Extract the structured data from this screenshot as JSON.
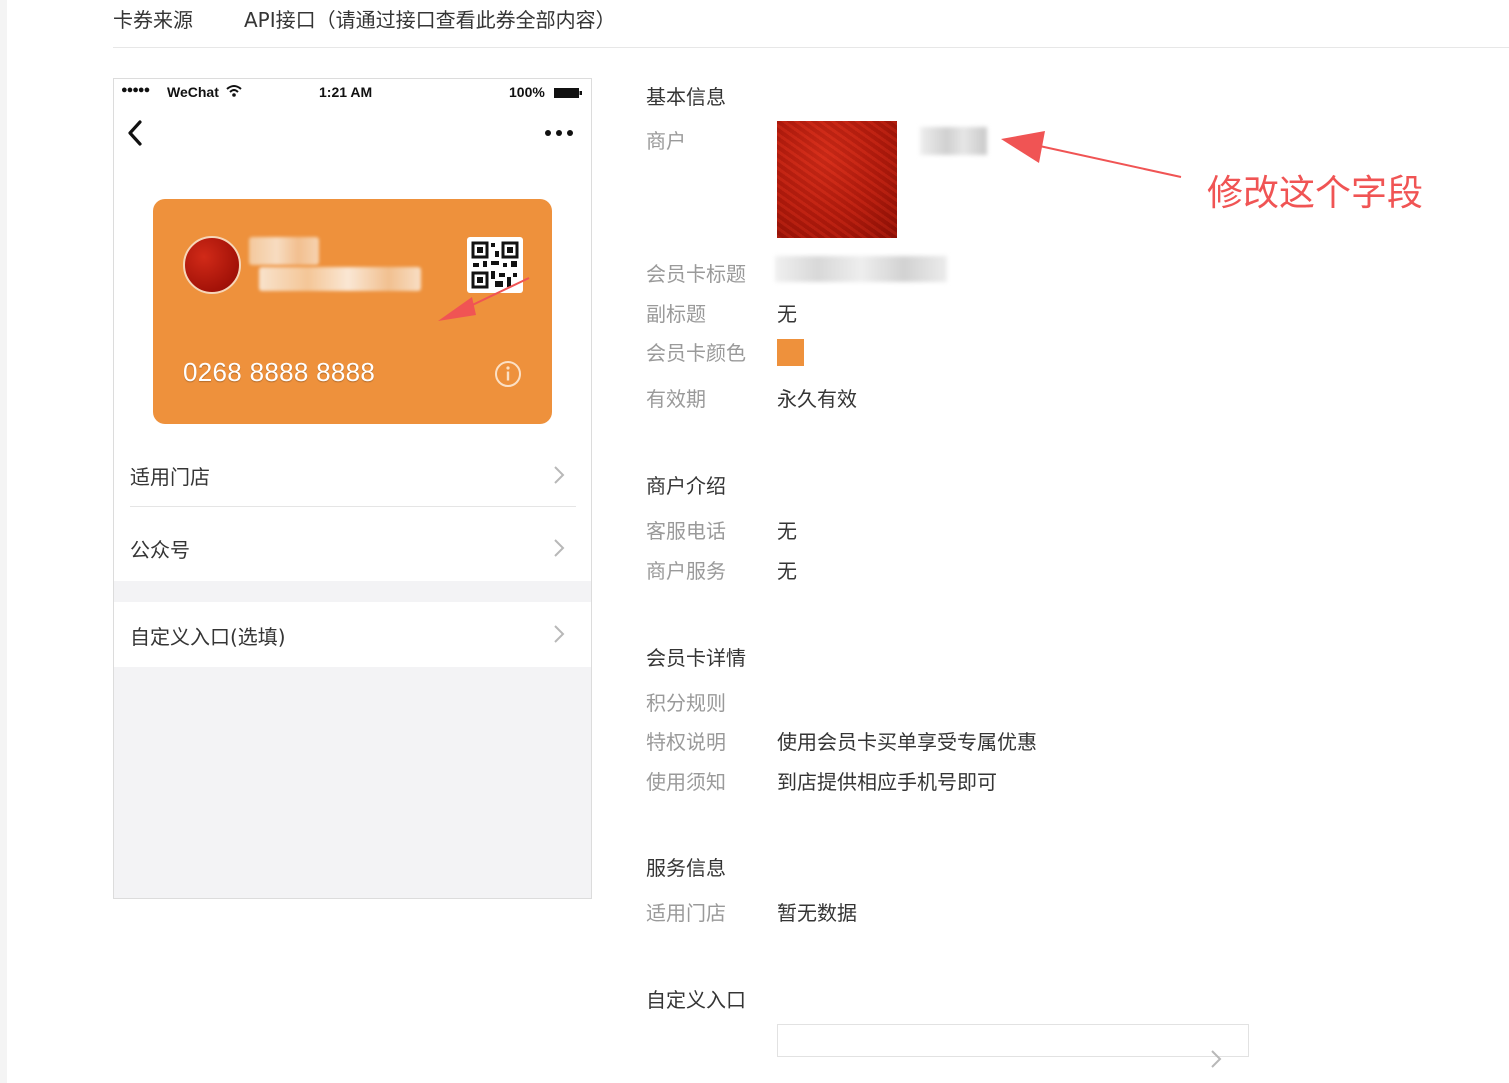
{
  "source": {
    "label": "卡券来源",
    "value": "API接口（请通过接口查看此券全部内容）"
  },
  "phone": {
    "status": {
      "signal": "●●●●●",
      "carrier": "WeChat",
      "time": "1:21 AM",
      "battery": "100%"
    },
    "card": {
      "number": "0268 8888 8888",
      "color": "#ee913c"
    },
    "menu": [
      {
        "label": "适用门店"
      },
      {
        "label": "公众号"
      }
    ],
    "custom_entry": {
      "label": "自定义入口(选填)"
    }
  },
  "basic_info": {
    "title": "基本信息",
    "merchant_label": "商户",
    "card_title_label": "会员卡标题",
    "subtitle_label": "副标题",
    "subtitle_value": "无",
    "color_label": "会员卡颜色",
    "color_value": "#ee913c",
    "validity_label": "有效期",
    "validity_value": "永久有效"
  },
  "merchant_intro": {
    "title": "商户介绍",
    "phone_label": "客服电话",
    "phone_value": "无",
    "service_label": "商户服务",
    "service_value": "无"
  },
  "card_details": {
    "title": "会员卡详情",
    "points_label": "积分规则",
    "privilege_label": "特权说明",
    "privilege_value": "使用会员卡买单享受专属优惠",
    "notice_label": "使用须知",
    "notice_value": "到店提供相应手机号即可"
  },
  "service_info": {
    "title": "服务信息",
    "stores_label": "适用门店",
    "stores_value": "暂无数据"
  },
  "custom_entry_section": {
    "title": "自定义入口"
  },
  "annotation": {
    "text": "修改这个字段",
    "color": "#f05454"
  }
}
